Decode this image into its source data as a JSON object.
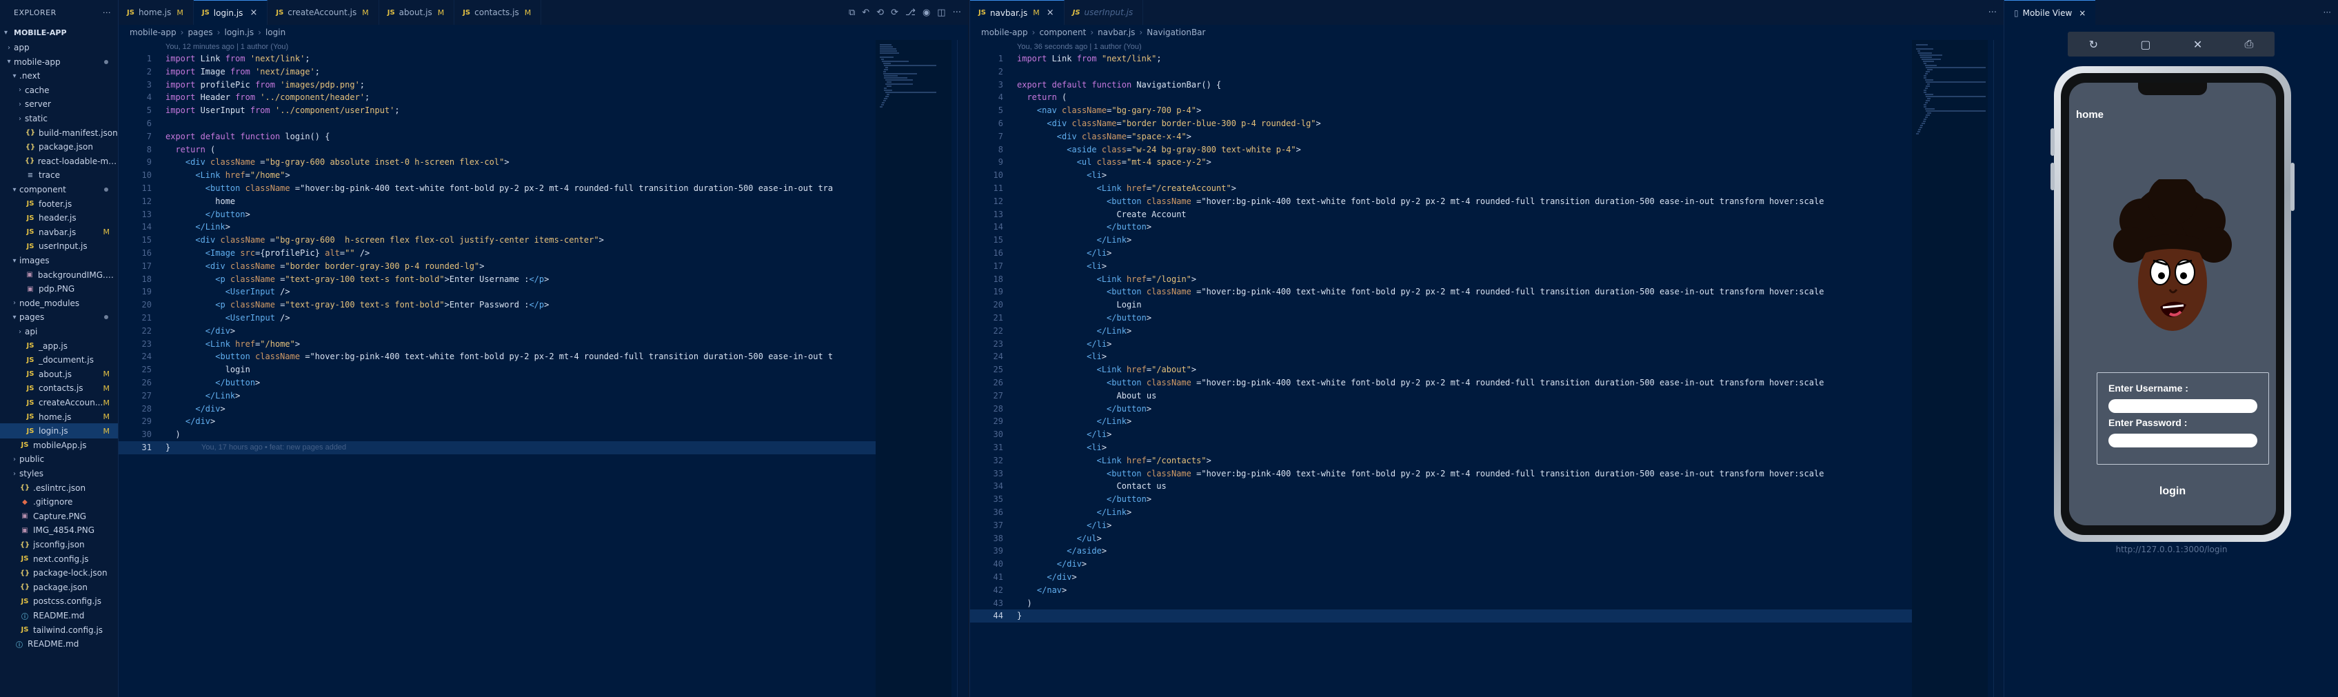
{
  "explorer": {
    "title": "EXPLORER",
    "root": "MOBILE-APP",
    "items": [
      {
        "name": "app",
        "type": "folder",
        "open": false,
        "depth": 1
      },
      {
        "name": "mobile-app",
        "type": "folder",
        "open": true,
        "depth": 1,
        "dot": true
      },
      {
        "name": ".next",
        "type": "folder",
        "open": true,
        "depth": 2
      },
      {
        "name": "cache",
        "type": "folder",
        "open": false,
        "depth": 3
      },
      {
        "name": "server",
        "type": "folder",
        "open": false,
        "depth": 3
      },
      {
        "name": "static",
        "type": "folder",
        "open": false,
        "depth": 3
      },
      {
        "name": "build-manifest.json",
        "type": "json",
        "depth": 3
      },
      {
        "name": "package.json",
        "type": "json",
        "depth": 3
      },
      {
        "name": "react-loadable-ma...",
        "type": "json",
        "depth": 3
      },
      {
        "name": "trace",
        "type": "file",
        "depth": 3
      },
      {
        "name": "component",
        "type": "folder",
        "open": true,
        "depth": 2,
        "dot": true
      },
      {
        "name": "footer.js",
        "type": "js",
        "depth": 3
      },
      {
        "name": "header.js",
        "type": "js",
        "depth": 3
      },
      {
        "name": "navbar.js",
        "type": "js",
        "depth": 3,
        "badge": "M"
      },
      {
        "name": "userInput.js",
        "type": "js",
        "depth": 3
      },
      {
        "name": "images",
        "type": "folder",
        "open": true,
        "depth": 2
      },
      {
        "name": "backgroundIMG.png",
        "type": "img",
        "depth": 3
      },
      {
        "name": "pdp.PNG",
        "type": "img",
        "depth": 3
      },
      {
        "name": "node_modules",
        "type": "folder",
        "open": false,
        "depth": 2
      },
      {
        "name": "pages",
        "type": "folder",
        "open": true,
        "depth": 2,
        "dot": true
      },
      {
        "name": "api",
        "type": "folder",
        "open": false,
        "depth": 3
      },
      {
        "name": "_app.js",
        "type": "js",
        "depth": 3
      },
      {
        "name": "_document.js",
        "type": "js",
        "depth": 3
      },
      {
        "name": "about.js",
        "type": "js",
        "depth": 3,
        "badge": "M"
      },
      {
        "name": "contacts.js",
        "type": "js",
        "depth": 3,
        "badge": "M"
      },
      {
        "name": "createAccoun...",
        "type": "js",
        "depth": 3,
        "badge": "M"
      },
      {
        "name": "home.js",
        "type": "js",
        "depth": 3,
        "badge": "M"
      },
      {
        "name": "login.js",
        "type": "js",
        "depth": 3,
        "badge": "M",
        "selected": true
      },
      {
        "name": "mobileApp.js",
        "type": "js",
        "depth": 2
      },
      {
        "name": "public",
        "type": "folder",
        "open": false,
        "depth": 2
      },
      {
        "name": "styles",
        "type": "folder",
        "open": false,
        "depth": 2
      },
      {
        "name": ".eslintrc.json",
        "type": "json",
        "depth": 2
      },
      {
        "name": ".gitignore",
        "type": "git",
        "depth": 2
      },
      {
        "name": "Capture.PNG",
        "type": "img",
        "depth": 2
      },
      {
        "name": "IMG_4854.PNG",
        "type": "img",
        "depth": 2
      },
      {
        "name": "jsconfig.json",
        "type": "json",
        "depth": 2
      },
      {
        "name": "next.config.js",
        "type": "js",
        "depth": 2
      },
      {
        "name": "package-lock.json",
        "type": "json",
        "depth": 2
      },
      {
        "name": "package.json",
        "type": "json",
        "depth": 2
      },
      {
        "name": "postcss.config.js",
        "type": "js",
        "depth": 2
      },
      {
        "name": "README.md",
        "type": "md",
        "depth": 2
      },
      {
        "name": "tailwind.config.js",
        "type": "js",
        "depth": 2
      },
      {
        "name": "README.md",
        "type": "md",
        "depth": 1
      }
    ]
  },
  "editor1": {
    "tabs": [
      {
        "label": "home.js",
        "badge": "M",
        "active": false
      },
      {
        "label": "login.js",
        "badge": "",
        "active": true,
        "close": "×"
      },
      {
        "label": "createAccount.js",
        "badge": "M",
        "active": false
      },
      {
        "label": "about.js",
        "badge": "M",
        "active": false
      },
      {
        "label": "contacts.js",
        "badge": "M",
        "active": false
      }
    ],
    "breadcrumb": [
      "mobile-app",
      "pages",
      "login.js",
      "login"
    ],
    "annotation_top": "You, 12 minutes ago | 1 author (You)",
    "annotation_end": "You, 17 hours ago • feat: new pages added",
    "current_line": 31,
    "lines": [
      "import Link from 'next/link';",
      "import Image from 'next/image';",
      "import profilePic from 'images/pdp.png';",
      "import Header from '../component/header';",
      "import UserInput from '../component/userInput';",
      "",
      "export default function login() {",
      "  return (",
      "    <div className =\"bg-gray-600 absolute inset-0 h-screen flex-col\">",
      "      <Link href=\"/home\">",
      "        <button className =\"hover:bg-pink-400 text-white font-bold py-2 px-2 mt-4 rounded-full transition duration-500 ease-in-out tra",
      "          home",
      "        </button>",
      "      </Link>",
      "      <div className =\"bg-gray-600  h-screen flex flex-col justify-center items-center\">",
      "        <Image src={profilePic} alt=\"\" />",
      "        <div className =\"border border-gray-300 p-4 rounded-lg\">",
      "          <p className =\"text-gray-100 text-s font-bold\">Enter Username :</p>",
      "            <UserInput />",
      "          <p className =\"text-gray-100 text-s font-bold\">Enter Password :</p>",
      "            <UserInput />",
      "        </div>",
      "        <Link href=\"/home\">",
      "          <button className =\"hover:bg-pink-400 text-white font-bold py-2 px-2 mt-4 rounded-full transition duration-500 ease-in-out t",
      "            login",
      "          </button>",
      "        </Link>",
      "      </div>",
      "    </div>",
      "  )",
      "}"
    ]
  },
  "editor2": {
    "tabs": [
      {
        "label": "navbar.js",
        "badge": "M",
        "active": true,
        "close": "×"
      },
      {
        "label": "userInput.js",
        "badge": "",
        "active": false,
        "faded": true
      }
    ],
    "breadcrumb": [
      "mobile-app",
      "component",
      "navbar.js",
      "NavigationBar"
    ],
    "annotation_top": "You, 36 seconds ago | 1 author (You)",
    "current_line": 44,
    "lines": [
      "import Link from \"next/link\";",
      "",
      "export default function NavigationBar() {",
      "  return (",
      "    <nav className=\"bg-gary-700 p-4\">",
      "      <div className=\"border border-blue-300 p-4 rounded-lg\">",
      "        <div className=\"space-x-4\">",
      "          <aside class=\"w-24 bg-gray-800 text-white p-4\">",
      "            <ul class=\"mt-4 space-y-2\">",
      "              <li>",
      "                <Link href=\"/createAccount\">",
      "                  <button className =\"hover:bg-pink-400 text-white font-bold py-2 px-2 mt-4 rounded-full transition duration-500 ease-in-out transform hover:scale",
      "                    Create Account",
      "                  </button>",
      "                </Link>",
      "              </li>",
      "              <li>",
      "                <Link href=\"/login\">",
      "                  <button className =\"hover:bg-pink-400 text-white font-bold py-2 px-2 mt-4 rounded-full transition duration-500 ease-in-out transform hover:scale",
      "                    Login",
      "                  </button>",
      "                </Link>",
      "              </li>",
      "              <li>",
      "                <Link href=\"/about\">",
      "                  <button className =\"hover:bg-pink-400 text-white font-bold py-2 px-2 mt-4 rounded-full transition duration-500 ease-in-out transform hover:scale",
      "                    About us",
      "                  </button>",
      "                </Link>",
      "              </li>",
      "              <li>",
      "                <Link href=\"/contacts\">",
      "                  <button className =\"hover:bg-pink-400 text-white font-bold py-2 px-2 mt-4 rounded-full transition duration-500 ease-in-out transform hover:scale",
      "                    Contact us",
      "                  </button>",
      "                </Link>",
      "              </li>",
      "            </ul>",
      "          </aside>",
      "        </div>",
      "      </div>",
      "    </nav>",
      "  )",
      "}"
    ]
  },
  "mobile_view": {
    "tab_label": "Mobile View",
    "screen_title": "home",
    "username_label": "Enter Username :",
    "password_label": "Enter Password :",
    "login_text": "login",
    "url": "http://127.0.0.1:3000/login"
  },
  "colors": {
    "keyword": "#c678dd",
    "string": "#e5c07b",
    "tag": "#61afef",
    "attr": "#d19a66",
    "modified_badge": "#e2c044"
  }
}
